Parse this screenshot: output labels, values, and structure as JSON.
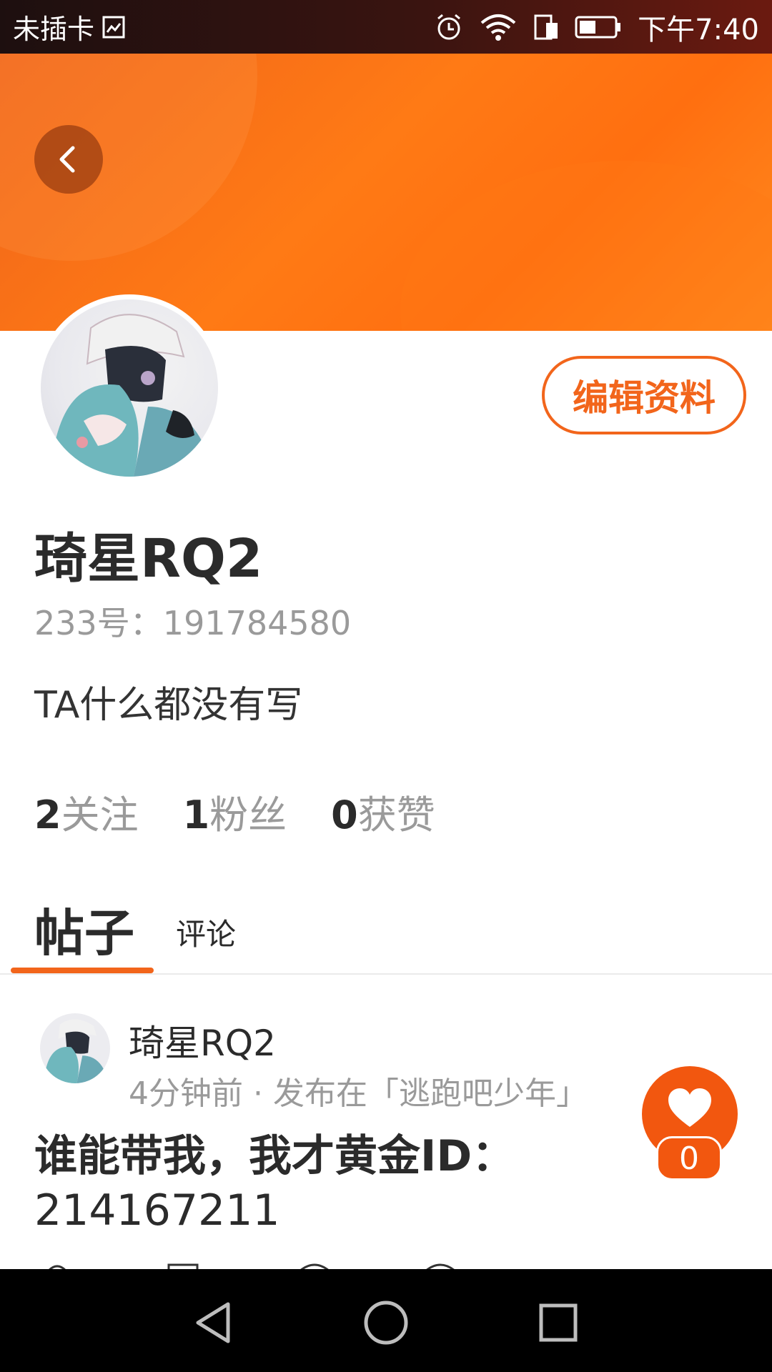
{
  "status_bar": {
    "carrier": "未插卡",
    "time": "下午7:40",
    "icons": [
      "sim-icon",
      "alarm-icon",
      "wifi-icon",
      "data-icon",
      "battery-icon"
    ]
  },
  "header": {
    "back_icon": "chevron-left-icon",
    "accent_color": "#ff7a15"
  },
  "profile": {
    "name": "琦星RQ2",
    "id_line": "233号：191784580",
    "bio": "TA什么都没有写",
    "edit_button": "编辑资料",
    "stats": [
      {
        "num": "2",
        "label": "关注"
      },
      {
        "num": "1",
        "label": "粉丝"
      },
      {
        "num": "0",
        "label": "获赞"
      }
    ]
  },
  "tabs": [
    {
      "label": "帖子",
      "active": true
    },
    {
      "label": "评论",
      "active": false
    }
  ],
  "post": {
    "author": "琦星RQ2",
    "meta": "4分钟前 · 发布在「逃跑吧少年」",
    "content_line1": "谁能带我，我才黄金ID：",
    "content_line2": "214167211",
    "likes": "0",
    "like_icon": "heart-icon"
  },
  "nav": {
    "icons": [
      "back-triangle-icon",
      "home-circle-icon",
      "recent-square-icon"
    ]
  }
}
